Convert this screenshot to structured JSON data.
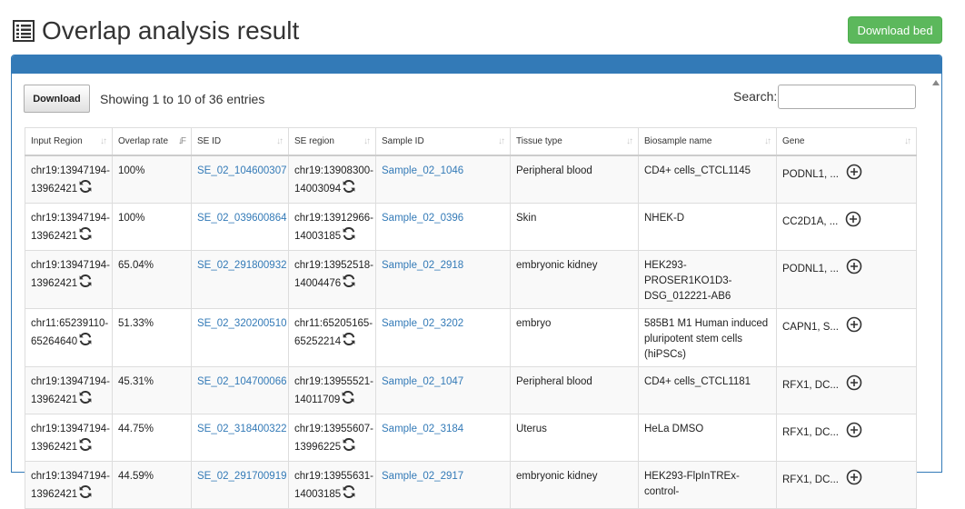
{
  "page": {
    "title": "Overlap analysis result",
    "download_bed": "Download bed"
  },
  "toolbar": {
    "download": "Download",
    "info": "Showing 1 to 10 of 36 entries",
    "search_label": "Search:",
    "search_value": ""
  },
  "table": {
    "columns": [
      "Input Region",
      "Overlap rate",
      "SE ID",
      "SE region",
      "Sample ID",
      "Tissue type",
      "Biosample name",
      "Gene"
    ],
    "sorted_column": "Overlap rate",
    "rows": [
      {
        "input_region": [
          "chr19:13947194-",
          "13962421"
        ],
        "overlap_rate": "100%",
        "se_id": "SE_02_104600307",
        "se_region": [
          "chr19:13908300-",
          "14003094"
        ],
        "sample_id": "Sample_02_1046",
        "tissue_type": "Peripheral blood",
        "biosample_name": [
          "CD4+ cells_CTCL1145"
        ],
        "gene": "PODNL1, ..."
      },
      {
        "input_region": [
          "chr19:13947194-",
          "13962421"
        ],
        "overlap_rate": "100%",
        "se_id": "SE_02_039600864",
        "se_region": [
          "chr19:13912966-",
          "14003185"
        ],
        "sample_id": "Sample_02_0396",
        "tissue_type": "Skin",
        "biosample_name": [
          "NHEK-D"
        ],
        "gene": "CC2D1A, ..."
      },
      {
        "input_region": [
          "chr19:13947194-",
          "13962421"
        ],
        "overlap_rate": "65.04%",
        "se_id": "SE_02_291800932",
        "se_region": [
          "chr19:13952518-",
          "14004476"
        ],
        "sample_id": "Sample_02_2918",
        "tissue_type": "embryonic kidney",
        "biosample_name": [
          "HEK293-PROSER1KO1D3-",
          "DSG_012221-AB6"
        ],
        "gene": "PODNL1, ..."
      },
      {
        "input_region": [
          "chr11:65239110-",
          "65264640"
        ],
        "overlap_rate": "51.33%",
        "se_id": "SE_02_320200510",
        "se_region": [
          "chr11:65205165-",
          "65252214"
        ],
        "sample_id": "Sample_02_3202",
        "tissue_type": "embryo",
        "biosample_name": [
          "585B1 M1 Human induced",
          "pluripotent stem cells",
          "(hiPSCs)"
        ],
        "gene": "CAPN1, S..."
      },
      {
        "input_region": [
          "chr19:13947194-",
          "13962421"
        ],
        "overlap_rate": "45.31%",
        "se_id": "SE_02_104700066",
        "se_region": [
          "chr19:13955521-",
          "14011709"
        ],
        "sample_id": "Sample_02_1047",
        "tissue_type": "Peripheral blood",
        "biosample_name": [
          "CD4+ cells_CTCL1181"
        ],
        "gene": "RFX1, DC..."
      },
      {
        "input_region": [
          "chr19:13947194-",
          "13962421"
        ],
        "overlap_rate": "44.75%",
        "se_id": "SE_02_318400322",
        "se_region": [
          "chr19:13955607-",
          "13996225"
        ],
        "sample_id": "Sample_02_3184",
        "tissue_type": "Uterus",
        "biosample_name": [
          "HeLa DMSO"
        ],
        "gene": "RFX1, DC..."
      },
      {
        "input_region": [
          "chr19:13947194-",
          "13962421"
        ],
        "overlap_rate": "44.59%",
        "se_id": "SE_02_291700919",
        "se_region": [
          "chr19:13955631-",
          "14003185"
        ],
        "sample_id": "Sample_02_2917",
        "tissue_type": "embryonic kidney",
        "biosample_name": [
          "HEK293-FlpInTREx-control-",
          ""
        ],
        "gene": "RFX1, DC..."
      }
    ]
  }
}
